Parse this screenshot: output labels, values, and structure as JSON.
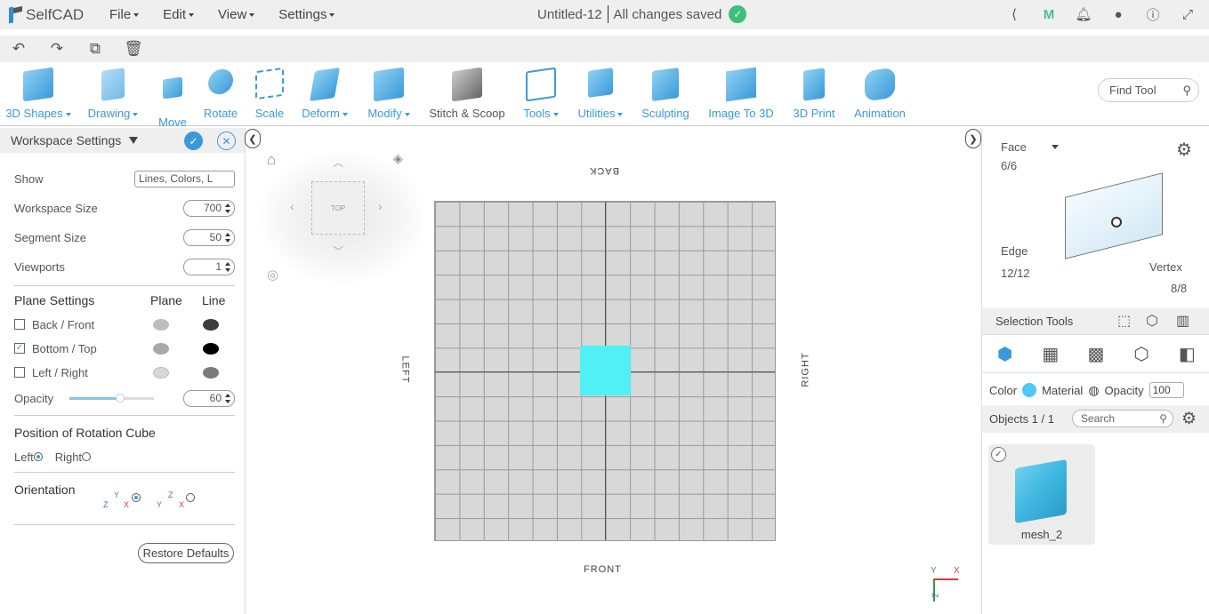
{
  "app": {
    "name": "SelfCAD",
    "menu": [
      "File",
      "Edit",
      "View",
      "Settings"
    ],
    "doc_title": "Untitled-12",
    "save_status": "All changes saved"
  },
  "top_icons": [
    "share-icon",
    "m-icon",
    "bell-icon",
    "user-icon",
    "info-icon",
    "fullscreen-icon"
  ],
  "toolbar": {
    "tools": [
      {
        "label": "3D Shapes",
        "dd": true
      },
      {
        "label": "Drawing",
        "dd": true
      },
      {
        "label": "Move",
        "dd": false
      },
      {
        "label": "Rotate",
        "dd": false
      },
      {
        "label": "Scale",
        "dd": false
      },
      {
        "label": "Deform",
        "dd": true
      },
      {
        "label": "Modify",
        "dd": true
      },
      {
        "label": "Stitch & Scoop",
        "dd": false
      },
      {
        "label": "Tools",
        "dd": true
      },
      {
        "label": "Utilities",
        "dd": true
      },
      {
        "label": "Sculpting",
        "dd": false
      },
      {
        "label": "Image To 3D",
        "dd": false
      },
      {
        "label": "3D Print",
        "dd": false
      },
      {
        "label": "Animation",
        "dd": false
      }
    ],
    "find_tool": "Find Tool"
  },
  "workspace": {
    "title": "Workspace Settings",
    "show_label": "Show",
    "show_value": "Lines, Colors, L",
    "ws_size_label": "Workspace Size",
    "ws_size": "700",
    "seg_label": "Segment Size",
    "seg_size": "50",
    "viewports_label": "Viewports",
    "viewports": "1",
    "plane_settings": "Plane Settings",
    "plane_col": "Plane",
    "line_col": "Line",
    "planes": [
      {
        "label": "Back / Front",
        "checked": false,
        "plane_color": "#bdbdbd",
        "line_color": "#3d3d3d"
      },
      {
        "label": "Bottom / Top",
        "checked": true,
        "plane_color": "#a9a9a9",
        "line_color": "#000000"
      },
      {
        "label": "Left / Right",
        "checked": false,
        "plane_color": "#d8d8d8",
        "line_color": "#7a7a7a"
      }
    ],
    "opacity_label": "Opacity",
    "opacity": "60",
    "opacity_fraction": 0.6,
    "rotation_cube_title": "Position of Rotation Cube",
    "left": "Left",
    "right": "Right",
    "orientation": "Orientation",
    "restore": "Restore Defaults"
  },
  "viewport": {
    "nav_label": "TOP",
    "back": "BACK",
    "front": "FRONT",
    "left": "LEFT",
    "right": "RIGHT",
    "axis_y": "Y",
    "axis_x": "X",
    "axis_z": "Z",
    "grid_color": "#d8d8d8",
    "object_color": "#50f0f5"
  },
  "selection": {
    "face": "Face",
    "face_count": "6/6",
    "edge": "Edge",
    "edge_count": "12/12",
    "vertex": "Vertex",
    "vertex_count": "8/8",
    "tools_label": "Selection Tools"
  },
  "properties": {
    "color": "Color",
    "color_value": "#50c8f5",
    "material": "Material",
    "opacity": "Opacity",
    "opacity_value": "100"
  },
  "objects": {
    "label": "Objects 1 / 1",
    "search_placeholder": "Search",
    "items": [
      {
        "name": "mesh_2"
      }
    ]
  }
}
